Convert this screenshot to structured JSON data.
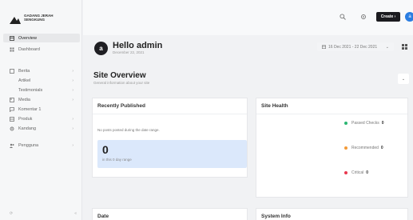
{
  "brand": {
    "line1": "GADANG JERAH",
    "line2": "SENGKUNG"
  },
  "sidebar": {
    "items": [
      {
        "label": "Overview",
        "chevron": ""
      },
      {
        "label": "Dashboard",
        "chevron": ""
      },
      {
        "label": "Berita",
        "chevron": "›"
      },
      {
        "label": "Artikel",
        "chevron": "›"
      },
      {
        "label": "Testimonials",
        "chevron": "›"
      },
      {
        "label": "Media",
        "chevron": "›"
      },
      {
        "label": "Komentar 1",
        "chevron": ""
      },
      {
        "label": "Produk",
        "chevron": "›"
      },
      {
        "label": "Kandang",
        "chevron": "›"
      },
      {
        "label": "Pengguna",
        "chevron": "›"
      }
    ],
    "bottom_left": "⟳",
    "bottom_right": "«"
  },
  "topbar": {
    "create_label": "Create ›",
    "avatar_initial": "a"
  },
  "greeting": {
    "avatar_initial": "a",
    "title": "Hello admin",
    "date": "December 22, 2021"
  },
  "date_range": {
    "label": "16 Dec 2021 - 22 Dec 2021",
    "caret": "⌄"
  },
  "overview": {
    "title": "Site Overview",
    "subtitle": "General information about your site",
    "collapse": "⌄"
  },
  "recently_published": {
    "title": "Recently Published",
    "empty": "No posts posted during the date range.",
    "count": "0",
    "count_label": "in this 0 day range"
  },
  "site_health": {
    "title": "Site Health",
    "rows": [
      {
        "label": "Passed Checks",
        "count": "0",
        "color": "#2bb673"
      },
      {
        "label": "Recommended",
        "count": "0",
        "color": "#f29a38"
      },
      {
        "label": "Critical",
        "count": "0",
        "color": "#e8384f"
      }
    ]
  },
  "bottom_cards": {
    "date_title": "Date",
    "system_title": "System Info"
  }
}
